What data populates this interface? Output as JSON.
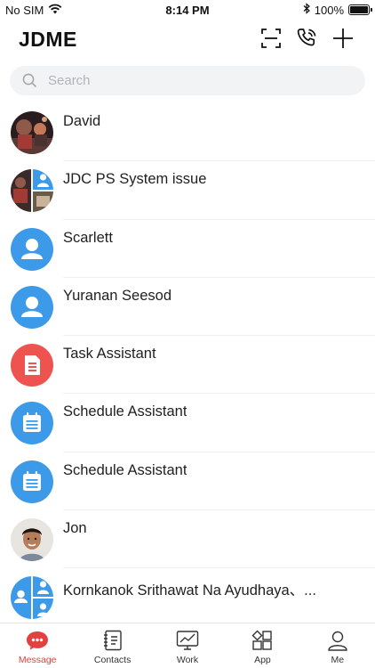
{
  "status_bar": {
    "carrier": "No SIM",
    "time": "8:14 PM",
    "battery": "100%",
    "battery_level": 1.0
  },
  "header": {
    "title": "JDME"
  },
  "search": {
    "placeholder": "Search"
  },
  "conversations": [
    {
      "name": "David",
      "avatar": "photo"
    },
    {
      "name": "JDC PS System issue",
      "avatar": "group-photo"
    },
    {
      "name": "Scarlett",
      "avatar": "default-user"
    },
    {
      "name": "Yuranan Seesod",
      "avatar": "default-user"
    },
    {
      "name": "Task Assistant",
      "avatar": "task-assistant"
    },
    {
      "name": "Schedule Assistant",
      "avatar": "schedule-assistant"
    },
    {
      "name": "Schedule Assistant",
      "avatar": "schedule-assistant"
    },
    {
      "name": "Jon",
      "avatar": "photo"
    },
    {
      "name": "Kornkanok Srithawat Na Ayudhaya、...",
      "avatar": "group-default"
    }
  ],
  "tabs": [
    {
      "label": "Message",
      "icon": "message-icon",
      "active": true
    },
    {
      "label": "Contacts",
      "icon": "contacts-icon",
      "active": false
    },
    {
      "label": "Work",
      "icon": "work-icon",
      "active": false
    },
    {
      "label": "App",
      "icon": "app-icon",
      "active": false
    },
    {
      "label": "Me",
      "icon": "me-icon",
      "active": false
    }
  ],
  "colors": {
    "accent": "#e1413f",
    "user_blue": "#3d9ae8",
    "task_red": "#ef5350",
    "search_bg": "#f2f3f5"
  }
}
